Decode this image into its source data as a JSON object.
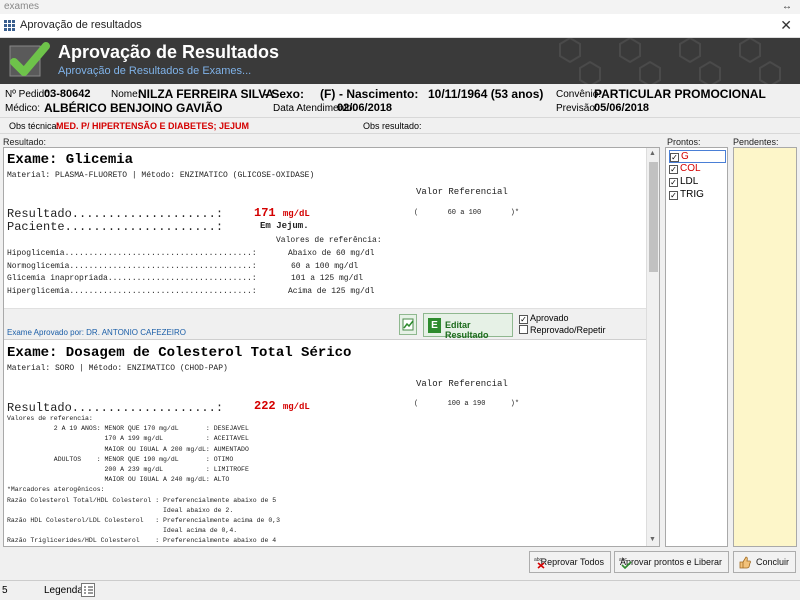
{
  "outer": {
    "label": "exames",
    "arrows": "↔"
  },
  "window": {
    "title": "Aprovação de resultados",
    "close": "✕"
  },
  "header": {
    "title": "Aprovação de Resultados",
    "subtitle": "Aprovação de Resultados de Exames..."
  },
  "patient": {
    "pedido_label": "Nº Pedido:",
    "pedido": "03-80642",
    "nome_label": "Nome:",
    "nome": "NILZA FERREIRA SILVA",
    "sexo_label": "- Sexo:",
    "sexo": "(F)",
    "nasc_label": "- Nascimento:",
    "nascimento": "10/11/1964 (53 anos)",
    "convenio_label": "Convênio:",
    "convenio": "PARTICULAR PROMOCIONAL",
    "medico_label": "Médico:",
    "medico": "ALBÉRICO BENJOINO GAVIÃO",
    "atend_label": "Data Atendimento:",
    "atendimento": "02/06/2018",
    "previsao_label": "Previsão:",
    "previsao": "05/06/2018"
  },
  "obs": {
    "tecnica_label": "Obs técnica:",
    "tecnica": "MED. P/ HIPERTENSÃO E DIABETES; JEJUM",
    "resultado_label": "Obs resultado:"
  },
  "labels": {
    "resultado": "Resultado:",
    "prontos": "Prontos:",
    "pendentes": "Pendentes:"
  },
  "exam1": {
    "title": "Exame: Glicemia",
    "material": "Material: PLASMA-FLUORETO | Método: ENZIMATICO (GLICOSE-OXIDASE)",
    "valor_ref_label": "Valor Referencial",
    "ref_range": "(       60 a 100       )*",
    "resultado_line": "Resultado....................:",
    "value": "171",
    "unit": "mg/dL",
    "paciente_line": "Paciente.....................:",
    "paciente_val": "Em Jejum.",
    "ref_header": "Valores de referência:",
    "ref_rows": [
      {
        "label": "Hipoglicemia.......................................:",
        "value": "Abaixo de 60 mg/dl"
      },
      {
        "label": "Normoglicemia......................................:",
        "value": "60 a 100 mg/dl"
      },
      {
        "label": "Glicemia inapropriada..............................:",
        "value": "101 a 125 mg/dl"
      },
      {
        "label": "Hiperglicemia......................................:",
        "value": "Acima de 125 mg/dl"
      }
    ],
    "approved_by": "Exame Aprovado por: DR. ANTONIO CAFEZEIRO",
    "edit_label": "Editar Resultado",
    "aprovado": "Aprovado",
    "reprovado": "Reprovado/Repetir"
  },
  "exam2": {
    "title": "Exame: Dosagem de Colesterol Total Sérico",
    "material": "Material: SORO | Método: ENZIMATICO (CHOD-PAP)",
    "valor_ref_label": "Valor Referencial",
    "ref_range": "(       100 a 190      )*",
    "resultado_line": "Resultado....................:",
    "value": "222",
    "unit": "mg/dL",
    "lines": [
      "Valores de referencia:",
      "            2 A 19 ANOS: MENOR QUE 170 mg/dL       : DESEJAVEL",
      "                         170 A 199 mg/dL           : ACEITAVEL",
      "                         MAIOR OU IGUAL A 200 mg/dL: AUMENTADO",
      "            ADULTOS    : MENOR QUE 190 mg/dL       : OTIMO",
      "                         200 A 239 mg/dL           : LIMITROFE",
      "                         MAIOR OU IGUAL A 240 mg/dL: ALTO",
      "*Marcadores aterogênicos:",
      "Razão Colesterol Total/HDL Colesterol : Preferencialmente abaixo de 5",
      "                                        Ideal abaixo de 2.",
      "Razão HDL Colesterol/LDL Colesterol   : Preferencialmente acima de 0,3",
      "                                        Ideal acima de 0,4.",
      "Razão Triglicerides/HDL Colesterol    : Preferencialmente abaixo de 4",
      "                                        Ideal abaixo de 2."
    ]
  },
  "prontos": [
    {
      "label": "G",
      "color": "#d40000"
    },
    {
      "label": "COL",
      "color": "#d40000"
    },
    {
      "label": "LDL",
      "color": "#000000"
    },
    {
      "label": "TRIG",
      "color": "#000000"
    }
  ],
  "buttons": {
    "reprovar": "Reprovar Todos",
    "aprovar": "Aprovar prontos e Liberar",
    "concluir": "Concluir"
  },
  "status": {
    "legenda": "Legenda:",
    "left_mark": "5"
  }
}
